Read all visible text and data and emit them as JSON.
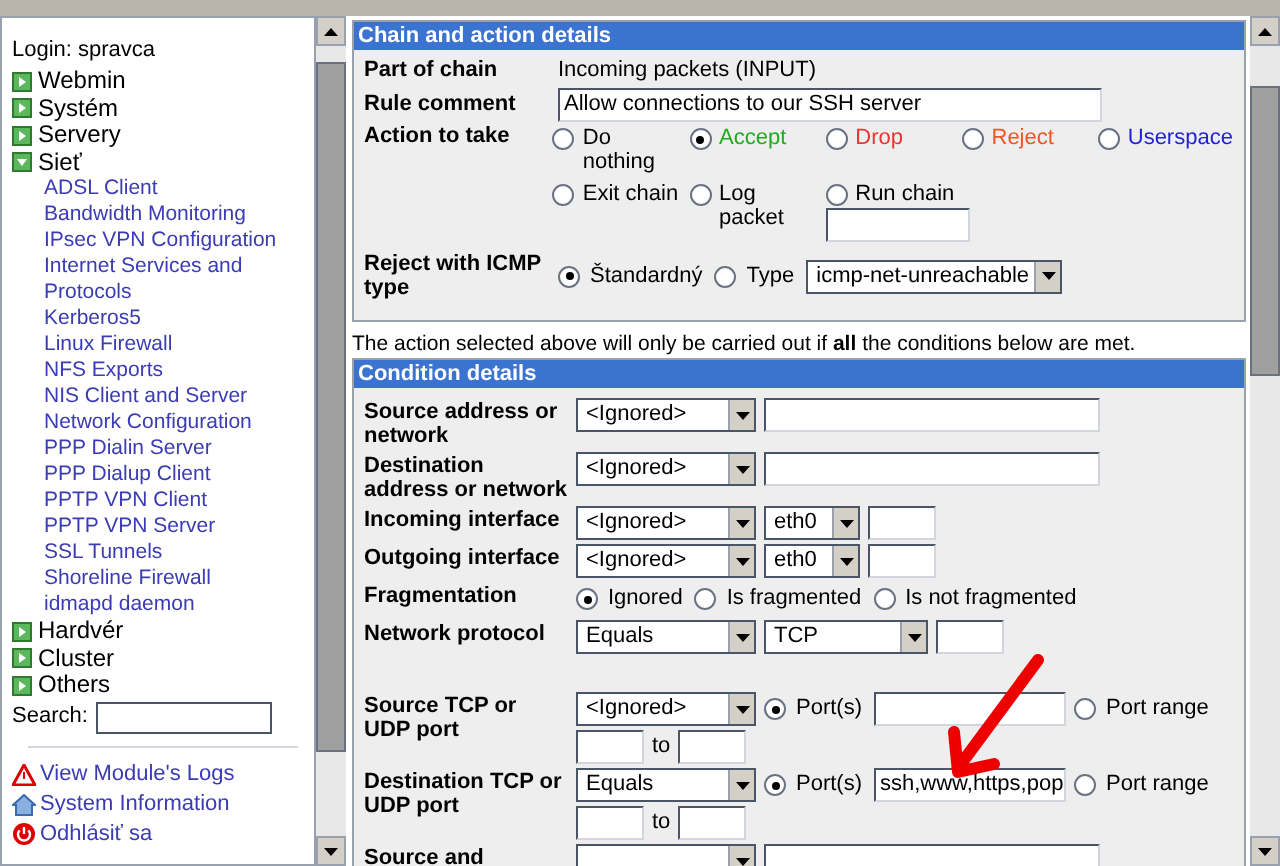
{
  "sidebar": {
    "login": "Login: spravca",
    "categories": [
      {
        "label": "Webmin",
        "expanded": false
      },
      {
        "label": "Systém",
        "expanded": false
      },
      {
        "label": "Servery",
        "expanded": false
      },
      {
        "label": "Sieť",
        "expanded": true,
        "children": [
          "ADSL Client",
          "Bandwidth Monitoring",
          "IPsec VPN Configuration",
          "Internet Services and Protocols",
          "Kerberos5",
          "Linux Firewall",
          "NFS Exports",
          "NIS Client and Server",
          "Network Configuration",
          "PPP Dialin Server",
          "PPP Dialup Client",
          "PPTP VPN Client",
          "PPTP VPN Server",
          "SSL Tunnels",
          "Shoreline Firewall",
          "idmapd daemon"
        ]
      },
      {
        "label": "Hardvér",
        "expanded": false
      },
      {
        "label": "Cluster",
        "expanded": false
      },
      {
        "label": "Others",
        "expanded": false
      }
    ],
    "search_label": "Search:",
    "links": [
      {
        "kind": "warning",
        "label": "View Module's Logs"
      },
      {
        "kind": "house",
        "label": "System Information"
      },
      {
        "kind": "power",
        "label": "Odhlásiť sa"
      }
    ]
  },
  "chain_section": {
    "title": "Chain and action details",
    "part_of_chain": {
      "label": "Part of chain",
      "value": "Incoming packets (INPUT)"
    },
    "rule_comment": {
      "label": "Rule comment",
      "value": "Allow connections to our SSH server"
    },
    "action": {
      "label": "Action to take",
      "options": [
        {
          "label": "Do nothing",
          "selected": false,
          "color": "#000000",
          "kind": "radio"
        },
        {
          "label": "Accept",
          "selected": true,
          "color": "#22aa22",
          "kind": "radio"
        },
        {
          "label": "Drop",
          "selected": false,
          "color": "#ee3333",
          "kind": "radio"
        },
        {
          "label": "Reject",
          "selected": false,
          "color": "#ee5522",
          "kind": "radio"
        },
        {
          "label": "Userspace",
          "selected": false,
          "color": "#2222dd",
          "kind": "radio"
        },
        {
          "label": "Exit chain",
          "selected": false,
          "color": "#000000",
          "kind": "radio"
        },
        {
          "label": "Log packet",
          "selected": false,
          "color": "#000000",
          "kind": "radio"
        },
        {
          "label": "Run chain",
          "selected": false,
          "color": "#000000",
          "kind": "radio-field"
        }
      ]
    },
    "icmp": {
      "label": "Reject with ICMP type",
      "options": [
        {
          "label": "Štandardný",
          "selected": true
        },
        {
          "label": "Type",
          "selected": false
        }
      ],
      "select": "icmp-net-unreachable"
    }
  },
  "note": "The action selected above will only be carried out if **all** the conditions below are met.",
  "condition_section": {
    "title": "Condition details",
    "rows": [
      {
        "label": "Source address or network",
        "controls": [
          {
            "kind": "select",
            "value": "<Ignored>"
          },
          {
            "kind": "long-input"
          }
        ]
      },
      {
        "label": "Destination address or network",
        "controls": [
          {
            "kind": "select",
            "value": "<Ignored>"
          },
          {
            "kind": "long-input"
          }
        ]
      },
      {
        "label": "Incoming interface",
        "controls": [
          {
            "kind": "select",
            "value": "<Ignored>"
          },
          {
            "kind": "short-select",
            "value": "eth0"
          },
          {
            "kind": "short-input"
          }
        ]
      },
      {
        "label": "Outgoing interface",
        "controls": [
          {
            "kind": "select",
            "value": "<Ignored>"
          },
          {
            "kind": "short-select",
            "value": "eth0"
          },
          {
            "kind": "short-input"
          }
        ]
      },
      {
        "label": "Fragmentation",
        "controls": [
          {
            "kind": "radio",
            "label": "Ignored",
            "selected": true
          },
          {
            "kind": "radio",
            "label": "Is fragmented",
            "selected": false
          },
          {
            "kind": "radio",
            "label": "Is not fragmented",
            "selected": false
          }
        ]
      },
      {
        "label": "Network protocol",
        "controls": [
          {
            "kind": "select",
            "value": "Equals"
          },
          {
            "kind": "mid-select",
            "value": "TCP"
          },
          {
            "kind": "short-input"
          },
          {
            "kind": "spacer"
          }
        ]
      },
      {
        "label": "Source TCP or UDP port",
        "controls": [
          {
            "kind": "select",
            "value": "<Ignored>"
          },
          {
            "kind": "radio",
            "label": "Port(s)",
            "selected": true
          },
          {
            "kind": "input"
          },
          {
            "kind": "radio",
            "label": "Port range",
            "selected": false
          },
          {
            "kind": "break"
          },
          {
            "kind": "short-input"
          },
          {
            "kind": "text",
            "label": "to"
          },
          {
            "kind": "short-input"
          }
        ]
      },
      {
        "label": "Destination TCP or UDP port",
        "controls": [
          {
            "kind": "select",
            "value": "Equals"
          },
          {
            "kind": "radio",
            "label": "Port(s)",
            "selected": true
          },
          {
            "kind": "input",
            "value": "ssh,www,https,pop"
          },
          {
            "kind": "radio",
            "label": "Port range",
            "selected": false
          },
          {
            "kind": "break"
          },
          {
            "kind": "short-input"
          },
          {
            "kind": "text",
            "label": "to"
          },
          {
            "kind": "short-input"
          }
        ]
      },
      {
        "label": "Source and",
        "controls": [
          {
            "kind": "select"
          },
          {
            "kind": "long-input"
          }
        ]
      }
    ]
  }
}
